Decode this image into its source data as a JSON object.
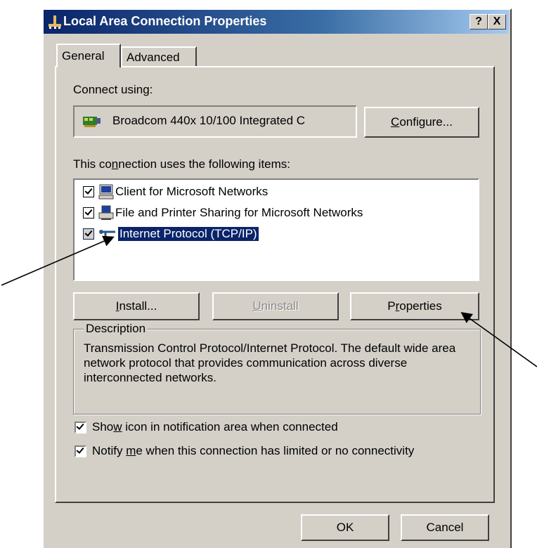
{
  "window": {
    "title": "Local Area Connection Properties",
    "help_button": "?",
    "close_button": "X"
  },
  "tabs": [
    {
      "label": "General",
      "selected": true
    },
    {
      "label": "Advanced",
      "selected": false
    }
  ],
  "connect_using": {
    "label": "Connect using:",
    "adapter": "Broadcom 440x 10/100 Integrated C",
    "configure_button": {
      "pre": "",
      "ul": "C",
      "post": "onfigure..."
    }
  },
  "items_section": {
    "label": {
      "pre": "This co",
      "ul": "n",
      "post": "nection uses the following items:"
    },
    "items": [
      {
        "label": "Client for Microsoft Networks",
        "checked": true,
        "selected": false,
        "icon": "computer-icon"
      },
      {
        "label": "File and Printer Sharing for Microsoft Networks",
        "checked": true,
        "selected": false,
        "icon": "printer-icon"
      },
      {
        "label": "Internet Protocol (TCP/IP)",
        "checked": true,
        "selected": true,
        "icon": "network-protocol-icon"
      }
    ]
  },
  "item_buttons": {
    "install": {
      "pre": "",
      "ul": "I",
      "post": "nstall..."
    },
    "uninstall": {
      "pre": "",
      "ul": "U",
      "post": "ninstall",
      "enabled": false
    },
    "properties": {
      "pre": "P",
      "ul": "r",
      "post": "operties"
    }
  },
  "description": {
    "legend": "Description",
    "text": "Transmission Control Protocol/Internet Protocol. The default wide area network protocol that provides communication across diverse interconnected networks."
  },
  "options": [
    {
      "pre": "Sho",
      "ul": "w",
      "post": " icon in notification area when connected",
      "checked": true
    },
    {
      "pre": "Notify ",
      "ul": "m",
      "post": "e when this connection has limited or no connectivity",
      "checked": true
    }
  ],
  "footer": {
    "ok": "OK",
    "cancel": "Cancel"
  },
  "colors": {
    "titlebar_start": "#0a246a",
    "titlebar_end": "#a6caf0",
    "dialog_face": "#d4d0c8",
    "selection": "#0a246a"
  }
}
